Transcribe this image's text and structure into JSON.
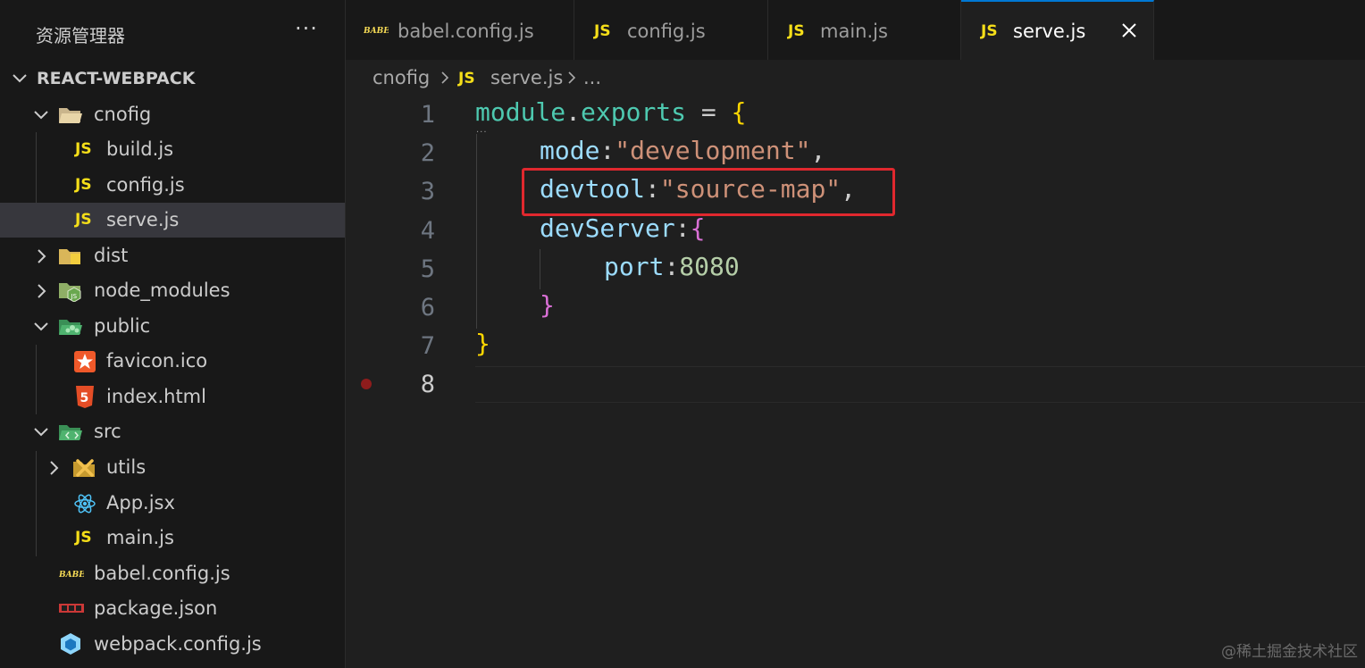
{
  "sidebar": {
    "title": "资源管理器",
    "more_label": "···",
    "section_title": "REACT-WEBPACK",
    "items": [
      {
        "label": "cnofig"
      },
      {
        "label": "build.js"
      },
      {
        "label": "config.js"
      },
      {
        "label": "serve.js"
      },
      {
        "label": "dist"
      },
      {
        "label": "node_modules"
      },
      {
        "label": "public"
      },
      {
        "label": "favicon.ico"
      },
      {
        "label": "index.html"
      },
      {
        "label": "src"
      },
      {
        "label": "utils"
      },
      {
        "label": "App.jsx"
      },
      {
        "label": "main.js"
      },
      {
        "label": "babel.config.js"
      },
      {
        "label": "package.json"
      },
      {
        "label": "webpack.config.js"
      }
    ],
    "js_badge": "JS"
  },
  "tabs": [
    {
      "label": "babel.config.js"
    },
    {
      "label": "config.js"
    },
    {
      "label": "main.js"
    },
    {
      "label": "serve.js"
    }
  ],
  "breadcrumb": {
    "folder": "cnofig",
    "file": "serve.js",
    "more": "..."
  },
  "editor": {
    "line_numbers": [
      "1",
      "2",
      "3",
      "4",
      "5",
      "6",
      "7",
      "8"
    ],
    "code": {
      "l1_module": "module",
      "l1_dot": ".",
      "l1_exports": "exports",
      "l1_eq": " = ",
      "l1_brace": "{",
      "l2_key": "mode",
      "l2_colon": ":",
      "l2_val": "\"development\"",
      "l2_comma": ",",
      "l3_key": "devtool",
      "l3_colon": ":",
      "l3_val": "\"source-map\"",
      "l3_comma": ",",
      "l4_key": "devServer",
      "l4_colon": ":",
      "l4_brace": "{",
      "l5_key": "port",
      "l5_colon": ":",
      "l5_val": "8080",
      "l6_brace": "}",
      "l7_brace": "}"
    }
  },
  "watermark": "@稀土掘金技术社区",
  "colors": {
    "active_tab_border": "#0078d4",
    "highlight_box": "#e0282e",
    "js_badge": "#f5de19"
  }
}
